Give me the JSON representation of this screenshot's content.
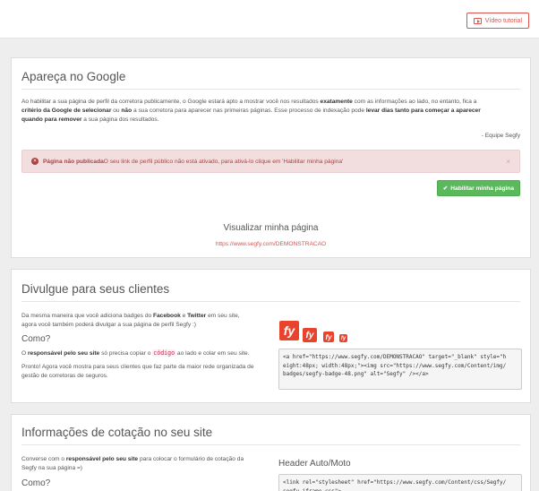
{
  "topbar": {
    "video_label": "Vídeo tutorial"
  },
  "google": {
    "title": "Apareça no Google",
    "intro_1": "Ao habilitar a sua página de perfil da corretora publicamente, o Google estará apto a mostrar você nos resultados ",
    "intro_b1": "exatamente",
    "intro_2": " com as informações ao lado, no entanto, fica a",
    "intro_b2": "critério da Google de selecionar",
    "intro_3": " ou ",
    "intro_b3": "não",
    "intro_4": " a sua corretora para aparecer nas primeiras páginas. Esse processo de indexação pode ",
    "intro_b4": "levar dias tanto para começar a aparecer",
    "intro_b5": "quando para remover",
    "intro_5": " a sua página dos resultados.",
    "signature": "- Equipe Segfy",
    "alert_title": "Página não publicada",
    "alert_text": " O seu link de perfil público não está ativado, para ativá-lo clique em 'Habilitar minha página'",
    "alert_close": "×",
    "enable_label": "Habilitar minha página",
    "view_label": "Visualizar minha página",
    "page_url": "https://www.segfy.com/DEMONSTRACAO"
  },
  "divulgue": {
    "title": "Divulgue para seus clientes",
    "intro_1": "Da mesma maneira que você adiciona badges do ",
    "intro_b1": "Facebook",
    "intro_2": " e ",
    "intro_b2": "Twitter",
    "intro_3": " em seu site,",
    "intro_4": "agora você também poderá divulgar a sua página de perfil Segfy :)",
    "como": "Como?",
    "how_b1": "responsável pelo seu site",
    "how_1": "O ",
    "how_2": " só precisa copiar o ",
    "how_code": "código",
    "how_3": " ao lado e colar em seu site.",
    "ready_1": "Pronto! Agora você mostra para seus clientes que faz parte da maior rede organizada de",
    "ready_2": "gestão de corretoras de seguros.",
    "badge_text": "fy",
    "code": "<a href=\"https://www.segfy.com/DEMONSTRACAO\" target=\"_blank\" style=\"h\neight:48px; width:48px;\"><img src=\"https://www.segfy.com/Content/img/\nbadges/segfy-badge-48.png\" alt=\"Segfy\" /></a>"
  },
  "cotacao": {
    "title": "Informações de cotação no seu site",
    "intro_1": "Converse com o ",
    "intro_b1": "responsável pelo seu site",
    "intro_2": " para colocar o formulário de cotação da",
    "intro_3": "Segfy na sua página =)",
    "como": "Como?",
    "header_label": "Header Auto/Moto",
    "code": "<link rel=\"stylesheet\" href=\"https://www.segfy.com/Content/css/Segfy/\nsegfy-iframe.css\">"
  }
}
